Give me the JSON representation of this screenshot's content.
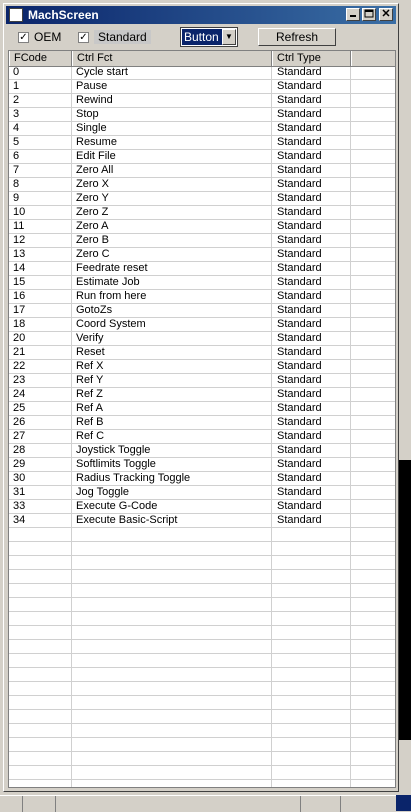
{
  "window": {
    "title": "MachScreen"
  },
  "toolbar": {
    "oem_label": "OEM",
    "oem_checked": "✓",
    "standard_label": "Standard",
    "standard_checked": "✓",
    "select_value": "Button",
    "select_arrow": "▼",
    "refresh_label": "Refresh"
  },
  "table": {
    "headers": [
      "FCode",
      "Ctrl Fct",
      "Ctrl Type"
    ],
    "rows": [
      [
        "0",
        "Cycle start",
        "Standard"
      ],
      [
        "1",
        "Pause",
        "Standard"
      ],
      [
        "2",
        "Rewind",
        "Standard"
      ],
      [
        "3",
        "Stop",
        "Standard"
      ],
      [
        "4",
        "Single",
        "Standard"
      ],
      [
        "5",
        "Resume",
        "Standard"
      ],
      [
        "6",
        "Edit File",
        "Standard"
      ],
      [
        "7",
        "Zero All",
        "Standard"
      ],
      [
        "8",
        "Zero X",
        "Standard"
      ],
      [
        "9",
        "Zero Y",
        "Standard"
      ],
      [
        "10",
        "Zero Z",
        "Standard"
      ],
      [
        "11",
        "Zero A",
        "Standard"
      ],
      [
        "12",
        "Zero B",
        "Standard"
      ],
      [
        "13",
        "Zero C",
        "Standard"
      ],
      [
        "14",
        "Feedrate reset",
        "Standard"
      ],
      [
        "15",
        "Estimate Job",
        "Standard"
      ],
      [
        "16",
        "Run from here",
        "Standard"
      ],
      [
        "17",
        "GotoZs",
        "Standard"
      ],
      [
        "18",
        "Coord System",
        "Standard"
      ],
      [
        "20",
        "Verify",
        "Standard"
      ],
      [
        "21",
        "Reset",
        "Standard"
      ],
      [
        "22",
        "Ref X",
        "Standard"
      ],
      [
        "23",
        "Ref Y",
        "Standard"
      ],
      [
        "24",
        "Ref Z",
        "Standard"
      ],
      [
        "25",
        "Ref A",
        "Standard"
      ],
      [
        "26",
        "Ref B",
        "Standard"
      ],
      [
        "27",
        "Ref C",
        "Standard"
      ],
      [
        "28",
        "Joystick Toggle",
        "Standard"
      ],
      [
        "29",
        "Softlimits Toggle",
        "Standard"
      ],
      [
        "30",
        "Radius Tracking Toggle",
        "Standard"
      ],
      [
        "31",
        "Jog Toggle",
        "Standard"
      ],
      [
        "33",
        "Execute G-Code",
        "Standard"
      ],
      [
        "34",
        "Execute Basic-Script",
        "Standard"
      ]
    ]
  },
  "colors": {
    "titlebar_start": "#0a246a",
    "titlebar_end": "#3a6ea5",
    "face": "#d4d0c8",
    "selection": "#0a246a"
  }
}
